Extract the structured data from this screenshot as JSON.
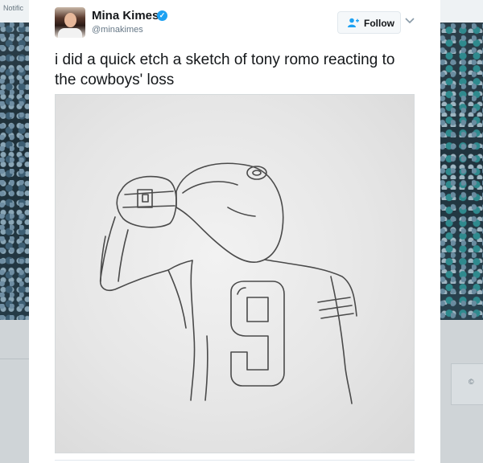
{
  "background": {
    "topbar_text": "Notific"
  },
  "tweet": {
    "author_name": "Mina Kimes",
    "author_handle": "@minakimes",
    "verified": true,
    "follow_label": "Follow",
    "text": "i did a quick etch a sketch of tony romo reacting to the cowboys' loss"
  },
  "icons": {
    "follow": "add-user-icon",
    "menu": "chevron-down-icon",
    "verified": "verified-badge-icon"
  },
  "colors": {
    "accent": "#1da1f2",
    "text": "#14171a",
    "secondary": "#657786"
  }
}
